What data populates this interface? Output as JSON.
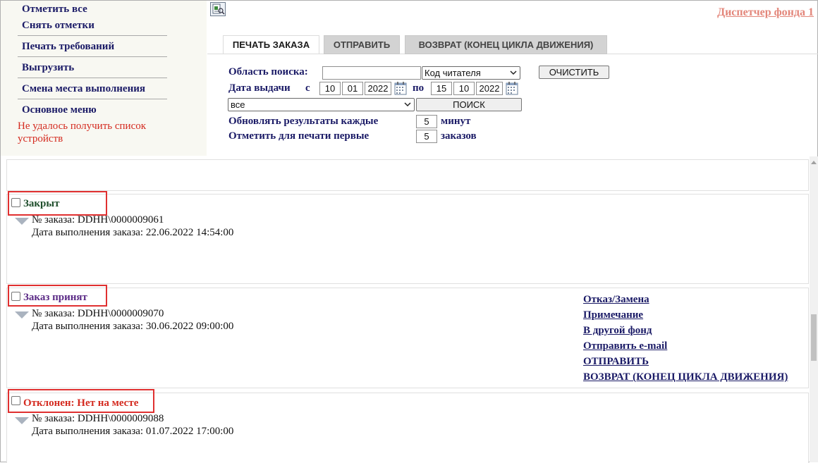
{
  "sidebar": {
    "links": [
      {
        "label": "Отметить все"
      },
      {
        "label": "Снять отметки"
      },
      {
        "label": "Печать требований"
      },
      {
        "label": "Выгрузить"
      },
      {
        "label": "Смена места выполнения"
      },
      {
        "label": "Основное меню"
      }
    ],
    "error": "Не удалось получить список устройств"
  },
  "header": {
    "fund_link": "Диспетчер фонда 1"
  },
  "tabs": [
    {
      "label": "ПЕЧАТЬ ЗАКАЗА",
      "active": true
    },
    {
      "label": "ОТПРАВИТЬ",
      "active": false
    },
    {
      "label": "ВОЗВРАТ (КОНЕЦ ЦИКЛА ДВИЖЕНИЯ)",
      "active": false
    }
  ],
  "form": {
    "search_area_label": "Область поиска:",
    "search_value": "",
    "search_field_select": "Код читателя",
    "clear_button": "ОЧИСТИТЬ",
    "issue_date_label": "Дата выдачи",
    "from_label": "с",
    "from_day": "10",
    "from_month": "01",
    "from_year": "2022",
    "to_label": "по",
    "to_day": "15",
    "to_month": "10",
    "to_year": "2022",
    "filter_select": "все",
    "search_button": "ПОИСК",
    "refresh_label": "Обновлять результаты каждые",
    "refresh_value": "5",
    "refresh_unit": "минут",
    "mark_label": "Отметить для печати первые",
    "mark_value": "5",
    "mark_unit": "заказов"
  },
  "orders": [
    {
      "status": "Закрыт",
      "status_color": "#1e4d2b",
      "number_line": "№ заказа: DDHH\\0000009061",
      "date_line": "Дата выполнения заказа: 22.06.2022 14:54:00"
    },
    {
      "status": "Заказ принят",
      "status_color": "#5b2a86",
      "number_line": "№ заказа: DDHH\\0000009070",
      "date_line": "Дата выполнения заказа: 30.06.2022 09:00:00",
      "actions": [
        {
          "label": "Отказ/Замена"
        },
        {
          "label": "Примечание"
        },
        {
          "label": "В другой фонд"
        },
        {
          "label": "Отправить e-mail"
        },
        {
          "label": "ОТПРАВИТЬ"
        },
        {
          "label": "ВОЗВРАТ (КОНЕЦ ЦИКЛА ДВИЖЕНИЯ)"
        }
      ]
    },
    {
      "status": "Отклонен: Нет на месте",
      "status_color": "#d42a1f",
      "number_line": "№ заказа: DDHH\\0000009088",
      "date_line": "Дата выполнения заказа: 01.07.2022 17:00:00"
    }
  ],
  "colors": {
    "link": "#1a1a66",
    "error": "#d42a1f",
    "fund_link": "#e3867a",
    "highlight_box": "#e03030"
  }
}
